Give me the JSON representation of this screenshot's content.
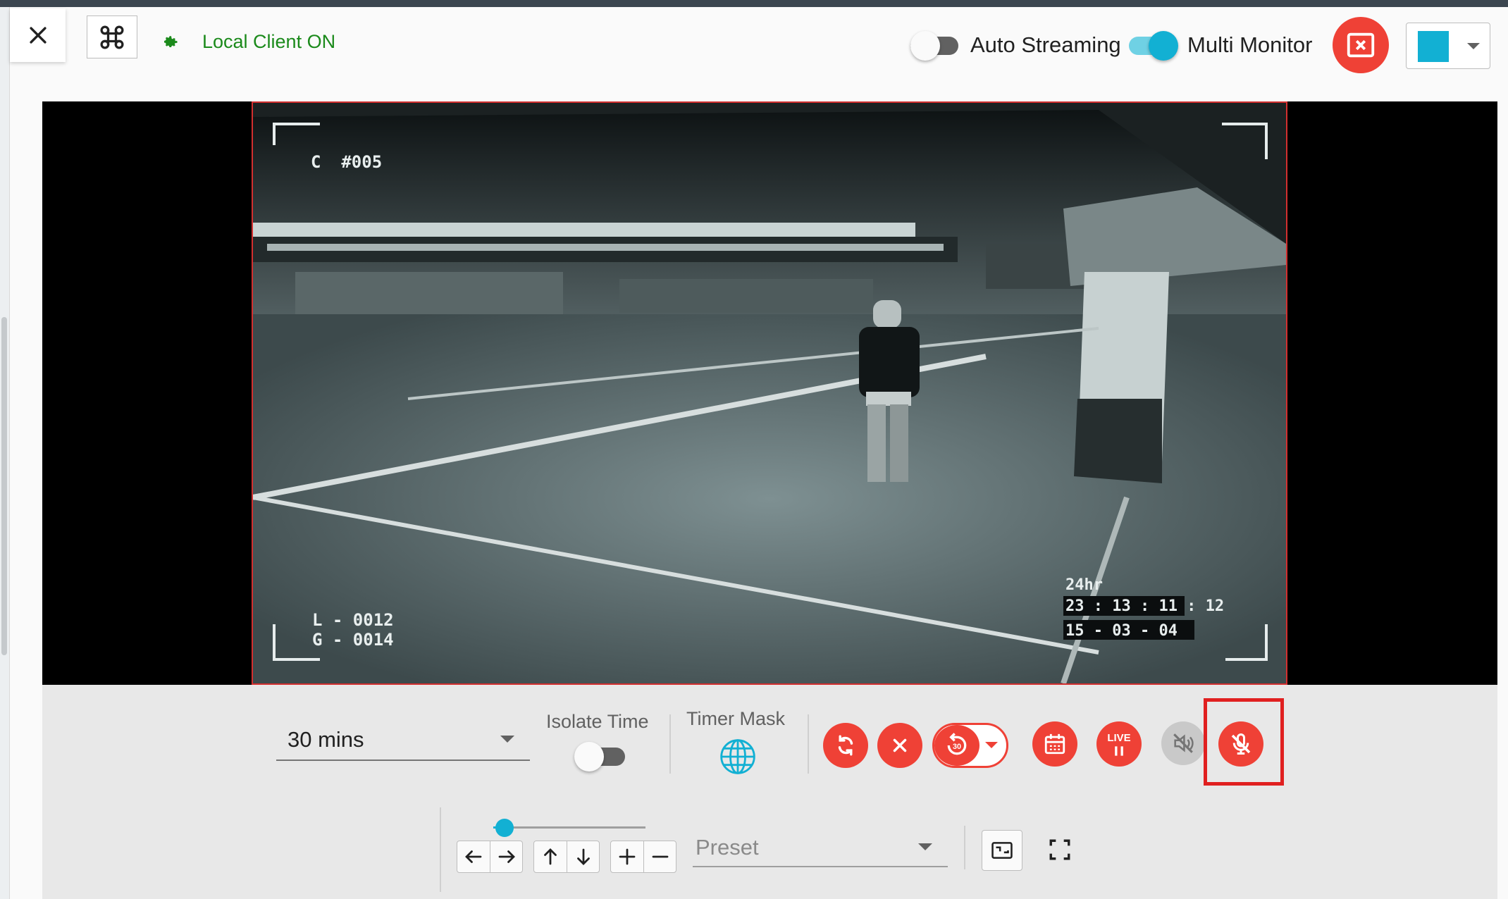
{
  "header": {
    "local_client_status": "Local Client ON",
    "auto_streaming_label": "Auto Streaming",
    "auto_streaming_on": false,
    "multi_monitor_label": "Multi Monitor",
    "multi_monitor_on": true,
    "monitor_color": "#12b0d3",
    "status_color": "#1b8a1b",
    "accent_red": "#ef4136"
  },
  "video": {
    "camera_id": "C  #005",
    "overlay_line1": "L - 0012",
    "overlay_line2": "G - 0014",
    "time_mode": "24hr",
    "timestamp": "23 : 13 : 11 : 12",
    "date": "15 - 03 - 04",
    "border_color": "#d32f2f"
  },
  "controls": {
    "duration_value": "30 mins",
    "isolate_time_label": "Isolate Time",
    "isolate_time_on": false,
    "timer_mask_label": "Timer Mask",
    "live_label": "LIVE",
    "rewind_label": "30",
    "buttons": [
      "refresh-icon",
      "close-icon",
      "rewind-30-icon",
      "calendar-icon",
      "live-pause-icon",
      "speaker-mute-icon",
      "mic-off-icon"
    ],
    "zoom_level": 0.05,
    "preset_placeholder": "Preset"
  }
}
